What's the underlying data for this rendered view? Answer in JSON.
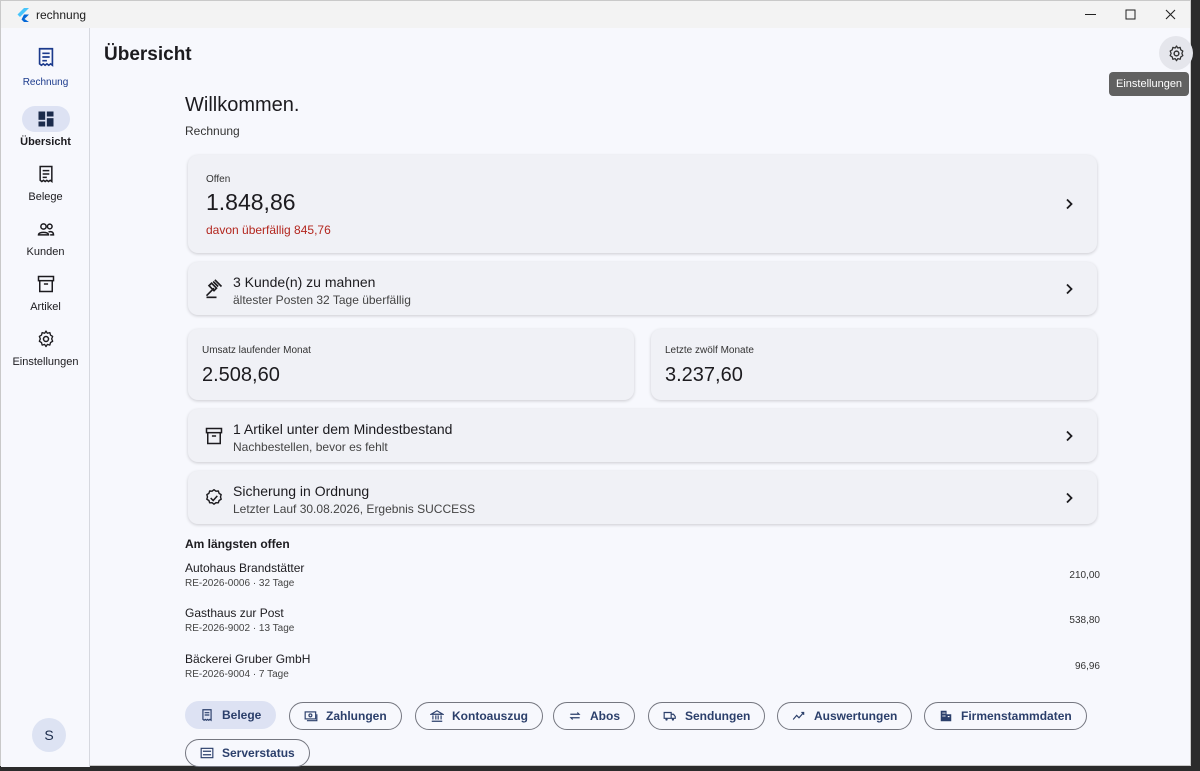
{
  "window": {
    "title": "rechnung"
  },
  "rail": {
    "brand_label": "Rechnung",
    "items": [
      {
        "label": "Übersicht",
        "icon": "dashboard-icon",
        "active": true
      },
      {
        "label": "Belege",
        "icon": "receipt-icon",
        "active": false
      },
      {
        "label": "Kunden",
        "icon": "people-icon",
        "active": false
      },
      {
        "label": "Artikel",
        "icon": "archive-icon",
        "active": false
      },
      {
        "label": "Einstellungen",
        "icon": "gear-icon",
        "active": false
      }
    ],
    "avatar_letter": "S"
  },
  "header": {
    "title": "Übersicht",
    "settings_tooltip": "Einstellungen"
  },
  "welcome": {
    "title": "Willkommen.",
    "subtitle": "Rechnung"
  },
  "open_card": {
    "label": "Offen",
    "value": "1.848,86",
    "overdue": "davon überfällig 845,76"
  },
  "dunning_card": {
    "title": "3 Kunde(n) zu mahnen",
    "subtitle": "ältester Posten 32 Tage überfällig"
  },
  "revenue_month": {
    "label": "Umsatz laufender Monat",
    "value": "2.508,60"
  },
  "revenue_year": {
    "label": "Letzte zwölf Monate",
    "value": "3.237,60"
  },
  "stock_card": {
    "title": "1 Artikel unter dem Mindestbestand",
    "subtitle": "Nachbestellen, bevor es fehlt"
  },
  "backup_card": {
    "title": "Sicherung in Ordnung",
    "subtitle": "Letzter Lauf 30.08.2026, Ergebnis SUCCESS"
  },
  "longest_open": {
    "heading": "Am längsten offen",
    "items": [
      {
        "name": "Autohaus Brandstätter",
        "meta": "RE-2026-0006 · 32 Tage",
        "amount": "210,00"
      },
      {
        "name": "Gasthaus zur Post",
        "meta": "RE-2026-9002 · 13 Tage",
        "amount": "538,80"
      },
      {
        "name": "Bäckerei Gruber GmbH",
        "meta": "RE-2026-9004 · 7 Tage",
        "amount": "96,96"
      }
    ]
  },
  "chips": [
    {
      "label": "Belege",
      "icon": "receipt-icon",
      "active": true
    },
    {
      "label": "Zahlungen",
      "icon": "payments-icon",
      "active": false
    },
    {
      "label": "Kontoauszug",
      "icon": "bank-icon",
      "active": false
    },
    {
      "label": "Abos",
      "icon": "repeat-icon",
      "active": false
    },
    {
      "label": "Sendungen",
      "icon": "truck-icon",
      "active": false
    },
    {
      "label": "Auswertungen",
      "icon": "chart-icon",
      "active": false
    },
    {
      "label": "Firmenstammdaten",
      "icon": "building-icon",
      "active": false
    },
    {
      "label": "Serverstatus",
      "icon": "server-icon",
      "active": false
    }
  ],
  "colors": {
    "accent": "#1b3a8c",
    "active_bg": "#dde2f3",
    "overdue": "#b3261e",
    "card_bg": "#f0f1f6"
  }
}
